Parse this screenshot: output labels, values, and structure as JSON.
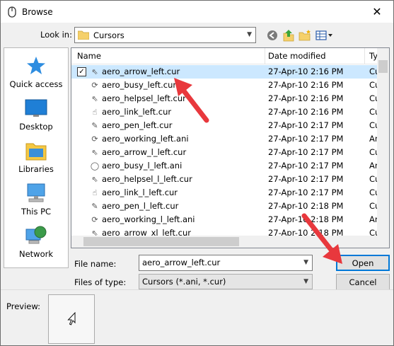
{
  "window": {
    "title": "Browse",
    "close_glyph": "✕"
  },
  "lookin": {
    "label": "Look in:",
    "value": "Cursors"
  },
  "toolbar": {
    "icons": [
      "back-icon",
      "up-folder-icon",
      "new-folder-icon",
      "view-menu-icon"
    ]
  },
  "places": [
    {
      "label": "Quick access",
      "icon": "star-icon"
    },
    {
      "label": "Desktop",
      "icon": "desktop-icon"
    },
    {
      "label": "Libraries",
      "icon": "libraries-icon"
    },
    {
      "label": "This PC",
      "icon": "computer-icon"
    },
    {
      "label": "Network",
      "icon": "network-icon"
    }
  ],
  "list": {
    "columns": {
      "name": "Name",
      "date": "Date modified",
      "type": "Ty"
    },
    "rows": [
      {
        "name": "aero_arrow_left.cur",
        "date": "27-Apr-10 2:16 PM",
        "type": "Cu",
        "selected": true,
        "checked": "✓"
      },
      {
        "name": "aero_busy_left.cur",
        "date": "27-Apr-10 2:16 PM",
        "type": "Cu"
      },
      {
        "name": "aero_helpsel_left.cur",
        "date": "27-Apr-10 2:16 PM",
        "type": "Cu"
      },
      {
        "name": "aero_link_left.cur",
        "date": "27-Apr-10 2:16 PM",
        "type": "Cu"
      },
      {
        "name": "aero_pen_left.cur",
        "date": "27-Apr-10 2:17 PM",
        "type": "Cu"
      },
      {
        "name": "aero_working_left.ani",
        "date": "27-Apr-10 2:17 PM",
        "type": "An"
      },
      {
        "name": "aero_arrow_l_left.cur",
        "date": "27-Apr-10 2:17 PM",
        "type": "Cu"
      },
      {
        "name": "aero_busy_l_left.ani",
        "date": "27-Apr-10 2:17 PM",
        "type": "An"
      },
      {
        "name": "aero_helpsel_l_left.cur",
        "date": "27-Apr-10 2:17 PM",
        "type": "Cu"
      },
      {
        "name": "aero_link_l_left.cur",
        "date": "27-Apr-10 2:17 PM",
        "type": "Cu"
      },
      {
        "name": "aero_pen_l_left.cur",
        "date": "27-Apr-10 2:18 PM",
        "type": "Cu"
      },
      {
        "name": "aero_working_l_left.ani",
        "date": "27-Apr-10 2:18 PM",
        "type": "An"
      },
      {
        "name": "aero_arrow_xl_left.cur",
        "date": "27-Apr-10 2:18 PM",
        "type": "Cu"
      }
    ]
  },
  "filename": {
    "label": "File name:",
    "value": "aero_arrow_left.cur"
  },
  "filetype": {
    "label": "Files of type:",
    "value": "Cursors (*.ani, *.cur)"
  },
  "buttons": {
    "open": "Open",
    "cancel": "Cancel"
  },
  "preview": {
    "label": "Preview:"
  },
  "colors": {
    "annotation_arrow": "#e8383d",
    "selection": "#cce8ff",
    "default_button_border": "#0078d7"
  }
}
